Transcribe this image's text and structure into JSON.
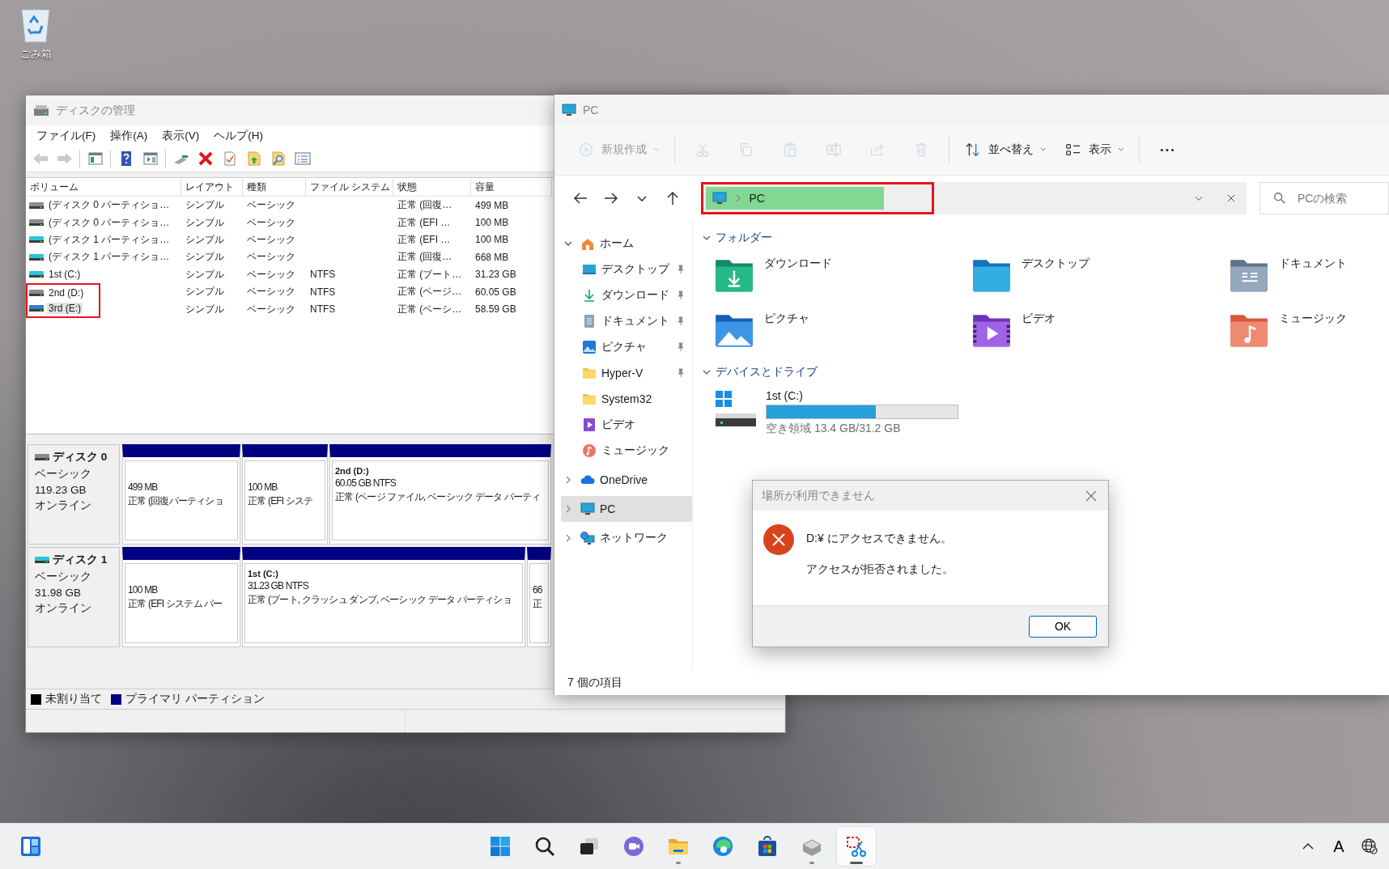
{
  "desktop_icons": [
    {
      "label": "ごみ箱"
    }
  ],
  "disk_management": {
    "title": "ディスクの管理",
    "menu": [
      "ファイル(F)",
      "操作(A)",
      "表示(V)",
      "ヘルプ(H)"
    ],
    "toolbar": [
      {
        "kind": "back",
        "disabled": true
      },
      {
        "kind": "forward",
        "disabled": true
      },
      {
        "kind": "tree",
        "disabled": false
      },
      {
        "kind": "help",
        "disabled": false
      },
      {
        "kind": "action",
        "disabled": false
      },
      {
        "kind": "connect",
        "disabled": false
      },
      {
        "kind": "delete",
        "disabled": false
      },
      {
        "kind": "check",
        "disabled": false
      },
      {
        "kind": "folder-up",
        "disabled": false
      },
      {
        "kind": "folder-search",
        "disabled": false
      },
      {
        "kind": "list",
        "disabled": false
      }
    ],
    "table": {
      "columns": [
        "ボリューム",
        "レイアウト",
        "種類",
        "ファイル システム",
        "状態",
        "容量"
      ],
      "rows": [
        {
          "kind": "hdd",
          "selected": false,
          "marked": false,
          "cells": [
            "(ディスク 0 パーティショ…",
            "シンプル",
            "ベーシック",
            "",
            "正常 (回復…",
            "499 MB"
          ]
        },
        {
          "kind": "hdd",
          "selected": false,
          "marked": false,
          "cells": [
            "(ディスク 0 パーティショ…",
            "シンプル",
            "ベーシック",
            "",
            "正常 (EFI …",
            "100 MB"
          ]
        },
        {
          "kind": "ssd",
          "selected": false,
          "marked": false,
          "cells": [
            "(ディスク 1 パーティショ…",
            "シンプル",
            "ベーシック",
            "",
            "正常 (EFI …",
            "100 MB"
          ]
        },
        {
          "kind": "ssd",
          "selected": false,
          "marked": false,
          "cells": [
            "(ディスク 1 パーティショ…",
            "シンプル",
            "ベーシック",
            "",
            "正常 (回復…",
            "668 MB"
          ]
        },
        {
          "kind": "ssd",
          "selected": false,
          "marked": false,
          "cells": [
            "1st (C:)",
            "シンプル",
            "ベーシック",
            "NTFS",
            "正常 (ブート…",
            "31.23 GB"
          ]
        },
        {
          "kind": "hdd",
          "selected": false,
          "marked": true,
          "cells": [
            "2nd (D:)",
            "シンプル",
            "ベーシック",
            "NTFS",
            "正常 (ページ…",
            "60.05 GB"
          ]
        },
        {
          "kind": "virtual",
          "selected": true,
          "marked": true,
          "cells": [
            "3rd (E:)",
            "シンプル",
            "ベーシック",
            "NTFS",
            "正常 (ベーシ…",
            "58.59 GB"
          ]
        }
      ]
    },
    "disks": [
      {
        "kind": "hdd",
        "name": "ディスク 0",
        "type": "ベーシック",
        "size": "119.23 GB",
        "status": "オンライン",
        "partitions": [
          {
            "lines": [
              "499 MB",
              "正常 (回復パーティショ"
            ]
          },
          {
            "lines": [
              "100 MB",
              "正常 (EFI システ"
            ]
          },
          {
            "title": "2nd  (D:)",
            "lines": [
              "60.05 GB NTFS",
              "正常 (ページ ファイル, ベーシック データ パーティ"
            ]
          }
        ]
      },
      {
        "kind": "ssd",
        "name": "ディスク 1",
        "type": "ベーシック",
        "size": "31.98 GB",
        "status": "オンライン",
        "partitions": [
          {
            "lines": [
              "100 MB",
              "正常 (EFI システム パー"
            ]
          },
          {
            "title": "1st  (C:)",
            "lines": [
              "31.23 GB NTFS",
              "正常 (ブート, クラッシュ ダンプ, ベーシック データ パーティショ"
            ]
          },
          {
            "lines": [
              "66",
              "正"
            ]
          }
        ]
      }
    ],
    "legend": [
      {
        "label": "未割り当て",
        "color": "#000000"
      },
      {
        "label": "プライマリ パーティション",
        "color": "#00007f"
      }
    ]
  },
  "explorer": {
    "title": "PC",
    "commands": [
      {
        "kind": "new",
        "label": "新規作成",
        "disabled": true
      },
      {
        "kind": "cut",
        "disabled": true
      },
      {
        "kind": "copy",
        "disabled": true
      },
      {
        "kind": "paste",
        "disabled": true
      },
      {
        "kind": "rename",
        "disabled": true
      },
      {
        "kind": "share",
        "disabled": true
      },
      {
        "kind": "delete",
        "disabled": true
      },
      {
        "kind": "sort",
        "label": "並べ替え",
        "disabled": false
      },
      {
        "kind": "view",
        "label": "表示",
        "disabled": false
      },
      {
        "kind": "more",
        "disabled": false
      }
    ],
    "address": {
      "crumbs": [
        "PC"
      ],
      "marked": true
    },
    "search": {
      "placeholder": "PCの検索"
    },
    "nav": [
      {
        "kind": "home",
        "label": "ホーム",
        "expanded": true,
        "selected": false,
        "children": [
          {
            "kind": "desktop",
            "label": "デスクトップ",
            "pinned": true,
            "selected": false
          },
          {
            "kind": "downloads",
            "label": "ダウンロード",
            "pinned": true,
            "selected": false
          },
          {
            "kind": "documents",
            "label": "ドキュメント",
            "pinned": true,
            "selected": false
          },
          {
            "kind": "pictures",
            "label": "ピクチャ",
            "pinned": true,
            "selected": false
          },
          {
            "kind": "folder",
            "label": "Hyper-V",
            "pinned": true,
            "selected": false
          },
          {
            "kind": "folder",
            "label": "System32",
            "pinned": false,
            "selected": false
          },
          {
            "kind": "videos",
            "label": "ビデオ",
            "pinned": false,
            "selected": false
          },
          {
            "kind": "music",
            "label": "ミュージック",
            "pinned": false,
            "selected": false
          }
        ]
      },
      {
        "kind": "cloud",
        "label": "OneDrive",
        "expanded": false,
        "selected": false
      },
      {
        "kind": "pc",
        "label": "PC",
        "expanded": false,
        "selected": true
      },
      {
        "kind": "network",
        "label": "ネットワーク",
        "expanded": false,
        "selected": false
      }
    ],
    "sections": [
      {
        "title": "フォルダー",
        "expanded": true,
        "folders": [
          {
            "kind": "downloads",
            "label": "ダウンロード"
          },
          {
            "kind": "desktop",
            "label": "デスクトップ"
          },
          {
            "kind": "documents",
            "label": "ドキュメント"
          },
          {
            "kind": "pictures",
            "label": "ピクチャ"
          },
          {
            "kind": "videos",
            "label": "ビデオ"
          },
          {
            "kind": "music",
            "label": "ミュージック"
          }
        ]
      },
      {
        "title": "デバイスとドライブ",
        "expanded": true,
        "drives": [
          {
            "label": "1st (C:)",
            "level": 0.57,
            "detail": "空き領域 13.4 GB/31.2 GB"
          }
        ]
      }
    ],
    "status": "7 個の項目"
  },
  "dialog": {
    "title": "場所が利用できません",
    "messages": [
      "D:¥ にアクセスできません。",
      "アクセスが拒否されました。"
    ],
    "buttons": [
      "OK"
    ]
  },
  "taskbar": {
    "apps": [
      {
        "kind": "widgets",
        "running": false,
        "active": false
      },
      {
        "kind": "start",
        "running": false,
        "active": false
      },
      {
        "kind": "search",
        "running": false,
        "active": false
      },
      {
        "kind": "taskview",
        "running": false,
        "active": false
      },
      {
        "kind": "chat",
        "running": false,
        "active": false
      },
      {
        "kind": "explorer",
        "running": true,
        "active": false
      },
      {
        "kind": "edge",
        "running": false,
        "active": false
      },
      {
        "kind": "store",
        "running": false,
        "active": false
      },
      {
        "kind": "diskmgmt",
        "running": true,
        "active": false
      },
      {
        "kind": "snipping",
        "running": true,
        "active": true
      }
    ],
    "tray": [
      {
        "kind": "chevron"
      },
      {
        "kind": "ime",
        "label": "A"
      },
      {
        "kind": "globe"
      }
    ]
  }
}
